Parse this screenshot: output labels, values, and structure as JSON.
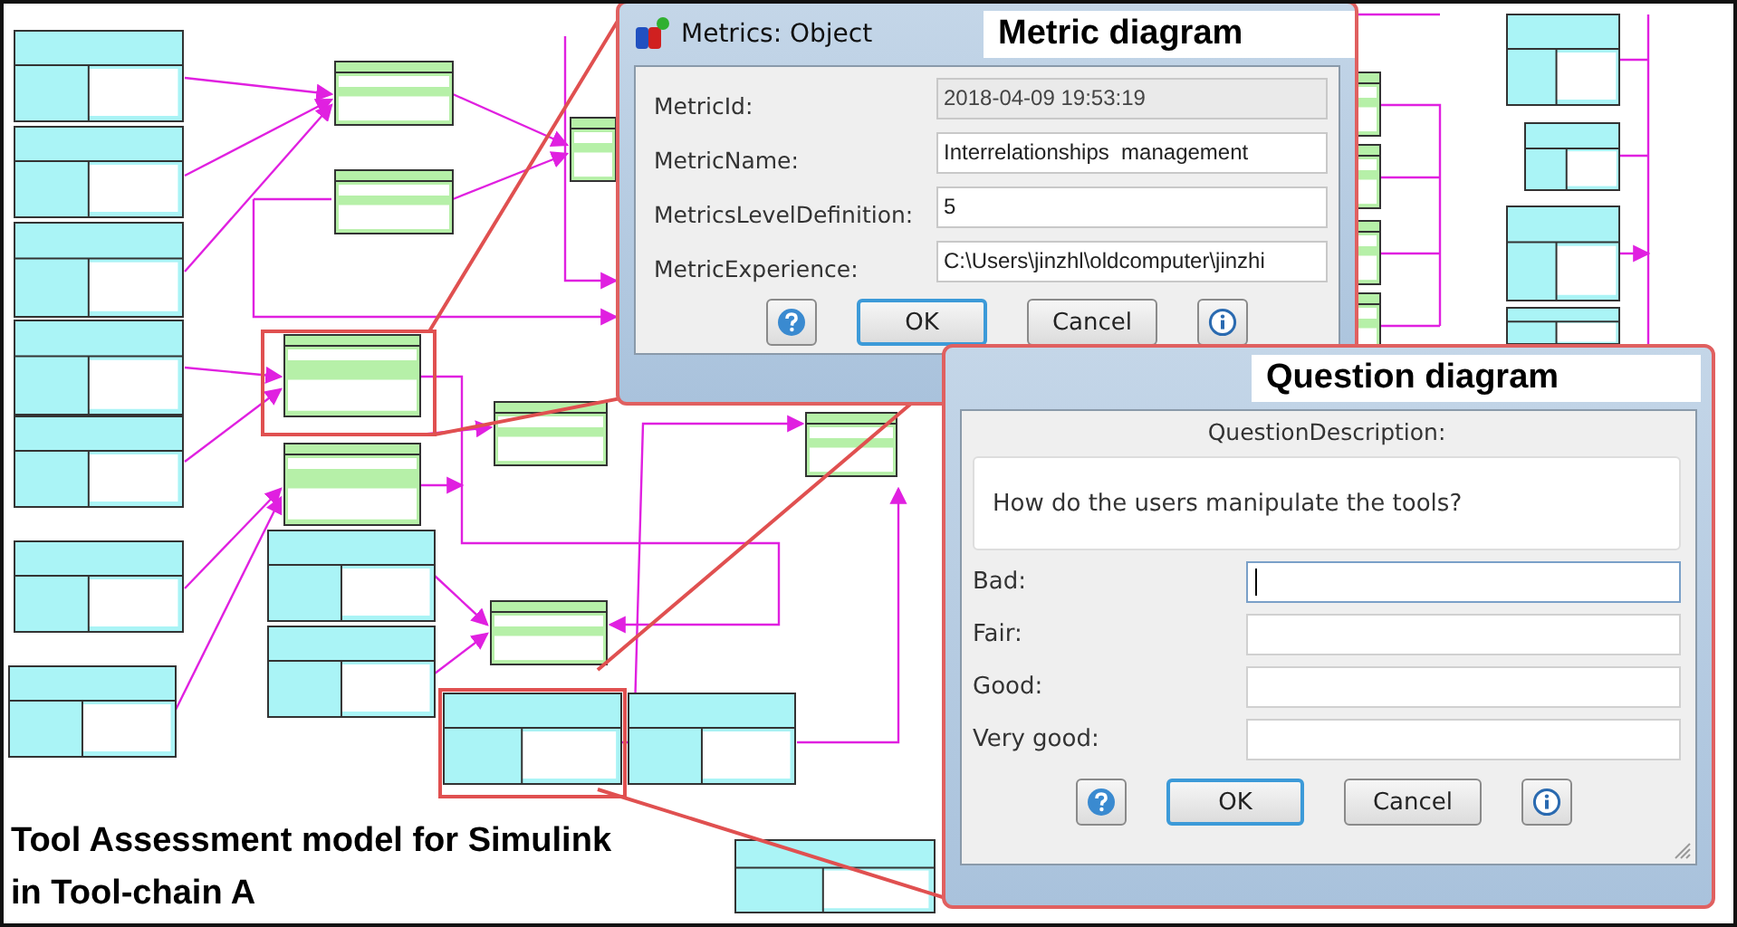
{
  "metric_dialog": {
    "title": "Metrics: Object",
    "tag": "Metric diagram",
    "fields": [
      {
        "label": "MetricId:",
        "value": "2018-04-09 19:53:19",
        "disabled": true
      },
      {
        "label": "MetricName:",
        "value": "Interrelationships  management",
        "disabled": false
      },
      {
        "label": "MetricsLevelDefinition:",
        "value": "5",
        "disabled": false
      },
      {
        "label": "MetricExperience:",
        "value": "C:\\Users\\jinzhl\\oldcomputer\\jinzhi",
        "disabled": false
      }
    ],
    "buttons": [
      {
        "kind": "help"
      },
      {
        "kind": "text",
        "label": "OK",
        "default": true
      },
      {
        "kind": "text",
        "label": "Cancel",
        "default": false
      },
      {
        "kind": "info"
      }
    ]
  },
  "question_dialog": {
    "tag": "Question diagram",
    "description_label": "QuestionDescription:",
    "description": "How do the users manipulate the tools?",
    "fields": [
      {
        "label": "Bad:",
        "focused": true
      },
      {
        "label": "Fair:",
        "focused": false
      },
      {
        "label": "Good:",
        "focused": false
      },
      {
        "label": "Very good:",
        "focused": false
      }
    ],
    "buttons": [
      {
        "kind": "help"
      },
      {
        "kind": "text",
        "label": "OK",
        "default": true
      },
      {
        "kind": "text",
        "label": "Cancel",
        "default": false
      },
      {
        "kind": "info"
      }
    ]
  },
  "caption": "Tool Assessment model for Simulink in Tool-chain A"
}
